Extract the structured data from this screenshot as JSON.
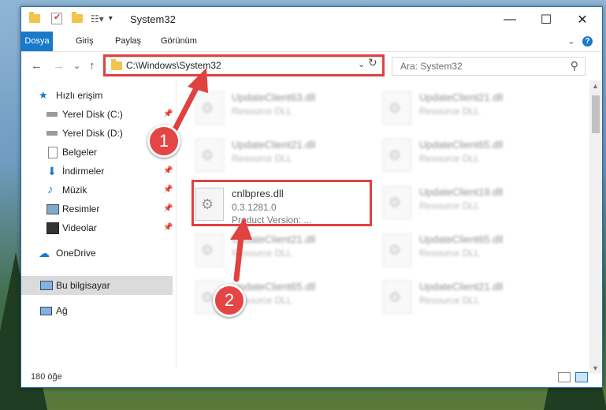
{
  "window": {
    "title": "System32"
  },
  "titlebar_buttons": {
    "minimize": "—",
    "maximize": "☐",
    "close": "✕"
  },
  "ribbon": {
    "tabs": [
      "Dosya",
      "Giriş",
      "Paylaş",
      "Görünüm"
    ],
    "help": "?",
    "collapse": "⌄"
  },
  "nav": {
    "back": "←",
    "forward": "→",
    "recent": "⌄",
    "up": "↑",
    "address": "C:\\Windows\\System32",
    "address_dropdown": "⌄",
    "refresh": "↻",
    "search_placeholder": "Ara: System32",
    "search_icon": "⚲"
  },
  "sidebar": {
    "items": [
      {
        "label": "Hızlı erişim",
        "icon": "star-icon",
        "pinned": false
      },
      {
        "label": "Yerel Disk (C:)",
        "icon": "drive-icon",
        "pinned": true
      },
      {
        "label": "Yerel Disk (D:)",
        "icon": "drive-icon",
        "pinned": false
      },
      {
        "label": "Belgeler",
        "icon": "documents-icon",
        "pinned": true
      },
      {
        "label": "İndirmeler",
        "icon": "download-icon",
        "pinned": true
      },
      {
        "label": "Müzik",
        "icon": "music-icon",
        "pinned": true
      },
      {
        "label": "Resimler",
        "icon": "pictures-icon",
        "pinned": true
      },
      {
        "label": "Videolar",
        "icon": "video-icon",
        "pinned": true
      },
      {
        "label": "OneDrive",
        "icon": "cloud-icon",
        "pinned": false
      },
      {
        "label": "Bu bilgisayar",
        "icon": "computer-icon",
        "pinned": false
      },
      {
        "label": "Ağ",
        "icon": "network-icon",
        "pinned": false
      }
    ],
    "pin_glyph": "📌"
  },
  "files": {
    "left_col": [
      {
        "name": "UpdateClient63.dll",
        "type": "Resource DLL"
      },
      {
        "name": "UpdateClient21.dll",
        "type": "Resource DLL"
      },
      {
        "name": "cnlbpres.dll",
        "version": "0.3.1281.0",
        "product": "Product Version:   ..."
      },
      {
        "name": "UpdateClient21.dll",
        "type": "Resource DLL"
      },
      {
        "name": "UpdateClient65.dll",
        "type": "Resource DLL"
      }
    ],
    "right_col": [
      {
        "name": "UpdateClient21.dll",
        "type": "Resource DLL"
      },
      {
        "name": "UpdateClient65.dll",
        "type": "Resource DLL"
      },
      {
        "name": "UpdateClient19.dll",
        "type": "Resource DLL"
      },
      {
        "name": "UpdateClient65.dll",
        "type": "Resource DLL"
      },
      {
        "name": "UpdateClient21.dll",
        "type": "Resource DLL"
      }
    ]
  },
  "status": {
    "count": "180 öğe"
  },
  "annotations": {
    "badge1": "1",
    "badge2": "2",
    "color": "#e04141"
  }
}
